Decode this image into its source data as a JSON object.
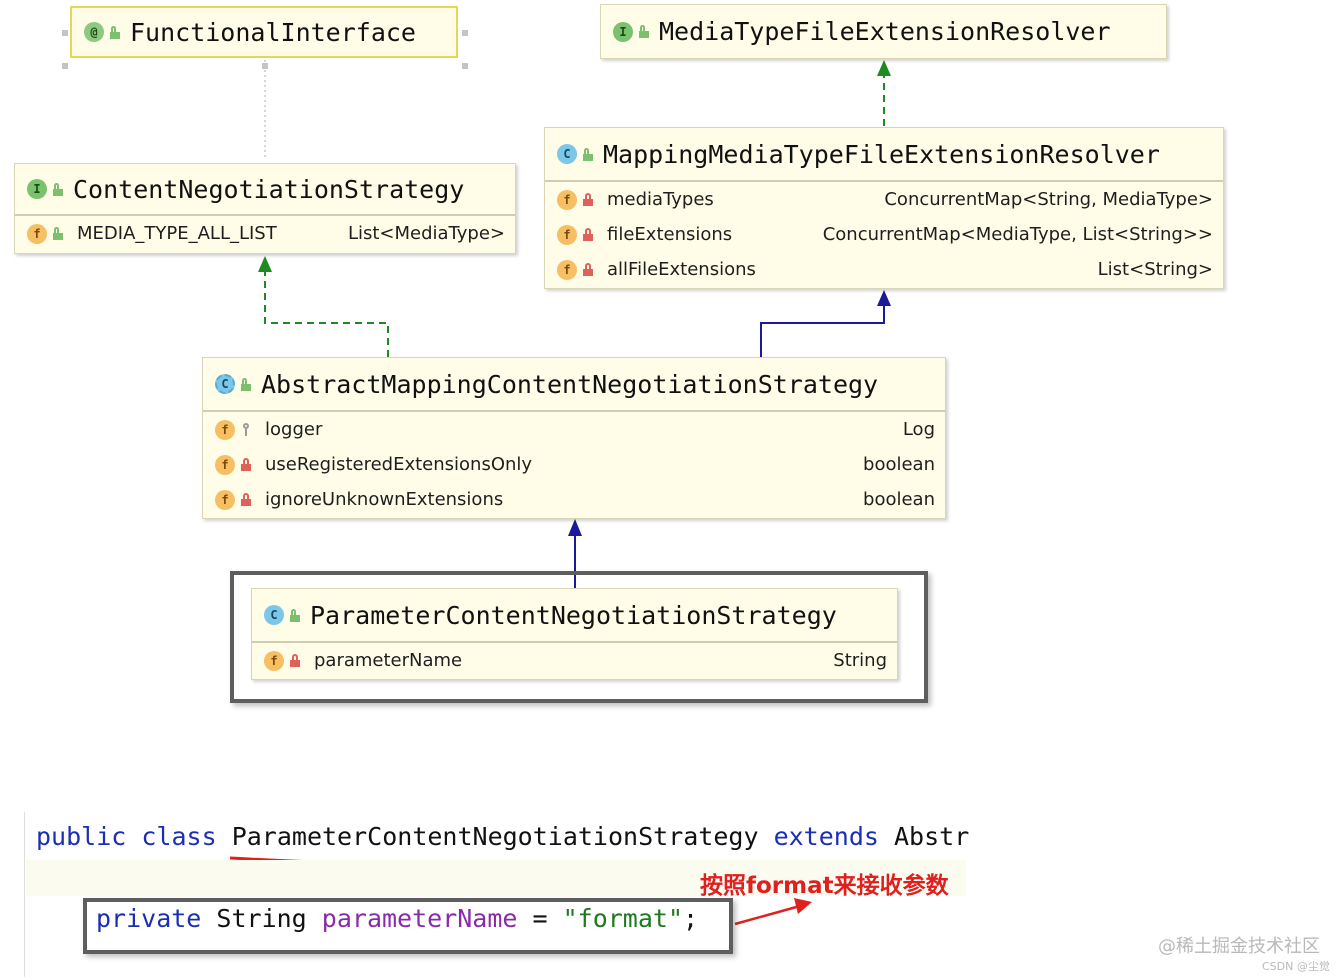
{
  "functional_interface": {
    "name": "FunctionalInterface",
    "icon": "annotation-icon"
  },
  "media_resolver": {
    "name": "MediaTypeFileExtensionResolver",
    "icon": "interface-icon"
  },
  "mapping_resolver": {
    "name": "MappingMediaTypeFileExtensionResolver",
    "icon": "class-icon",
    "fields": [
      {
        "name": "mediaTypes",
        "type": "ConcurrentMap<String, MediaType>"
      },
      {
        "name": "fileExtensions",
        "type": "ConcurrentMap<MediaType, List<String>>"
      },
      {
        "name": "allFileExtensions",
        "type": "List<String>"
      }
    ]
  },
  "content_strategy": {
    "name": "ContentNegotiationStrategy",
    "icon": "interface-icon",
    "fields": [
      {
        "name": "MEDIA_TYPE_ALL_LIST",
        "type": "List<MediaType>"
      }
    ]
  },
  "abstract_strategy": {
    "name": "AbstractMappingContentNegotiationStrategy",
    "icon": "abstract-class-icon",
    "fields": [
      {
        "name": "logger",
        "type": "Log"
      },
      {
        "name": "useRegisteredExtensionsOnly",
        "type": "boolean"
      },
      {
        "name": "ignoreUnknownExtensions",
        "type": "boolean"
      }
    ]
  },
  "param_strategy": {
    "name": "ParameterContentNegotiationStrategy",
    "icon": "class-icon",
    "fields": [
      {
        "name": "parameterName",
        "type": "String"
      }
    ]
  },
  "code": {
    "line1": {
      "kw1": "public",
      "kw2": "class",
      "cls": "ParameterContentNegotiationStrategy",
      "kw3": "extends",
      "rest": "Abstr"
    },
    "line2": {
      "kw": "private",
      "type": "String",
      "name": "parameterName",
      "eq": "=",
      "value": "\"format\"",
      "semi": ";"
    }
  },
  "annotation": "按照format来接收参数",
  "watermark": "@稀土掘金技术社区",
  "watermark_small": "CSDN @尘觉",
  "colors": {
    "box_bg": "#fffde7",
    "dashed_arrow": "#1f8a1f",
    "solid_arrow": "#1a1a9a",
    "keyword": "#1b2fb5",
    "string": "#1f7a1f",
    "annotation_red": "#e0201c"
  }
}
